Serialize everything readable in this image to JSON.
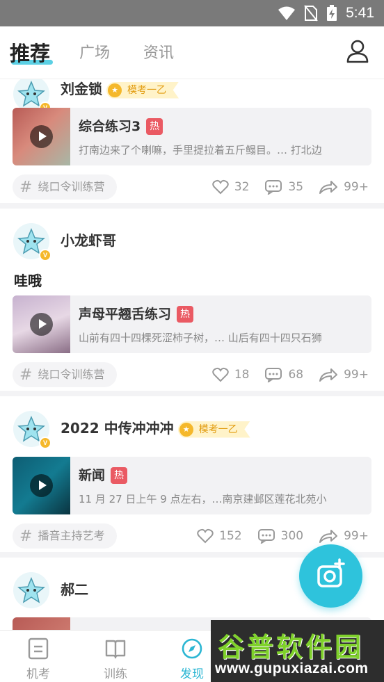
{
  "status_bar": {
    "time": "5:41"
  },
  "nav": {
    "tabs": [
      {
        "label": "推荐"
      },
      {
        "label": "广场"
      },
      {
        "label": "资讯"
      }
    ]
  },
  "posts": [
    {
      "username": "刘金锁",
      "level": "模考一乙",
      "card": {
        "title": "综合练习3",
        "hot": "热",
        "desc": "打南边来了个喇嘛，手里提拉着五斤鳎目。… 打北边"
      },
      "topic": "绕口令训练营",
      "likes": "32",
      "comments": "35",
      "shares": "99+"
    },
    {
      "username": "小龙虾哥",
      "text": "哇哦",
      "card": {
        "title": "声母平翘舌练习",
        "hot": "热",
        "desc": "山前有四十四棵死涩柿子树，… 山后有四十四只石狮"
      },
      "topic": "绕口令训练营",
      "likes": "18",
      "comments": "68",
      "shares": "99+"
    },
    {
      "username": "2022 中传冲冲冲",
      "level": "模考一乙",
      "card": {
        "title": "新闻",
        "hot": "热",
        "desc": "11 月 27 日上午 9 点左右，…南京建邺区莲花北苑小"
      },
      "topic": "播音主持艺考",
      "likes": "152",
      "comments": "300",
      "shares": "99+"
    },
    {
      "username": "郝二"
    }
  ],
  "bottom_bar": {
    "items": [
      {
        "label": "机考"
      },
      {
        "label": "训练"
      },
      {
        "label": "发现"
      }
    ]
  },
  "watermark": {
    "title": "谷普软件园",
    "url": "www.gupuxiazai.com"
  },
  "colors": {
    "accent": "#2ec3dc",
    "hot": "#ea5a63",
    "level": "#f5b82b"
  }
}
